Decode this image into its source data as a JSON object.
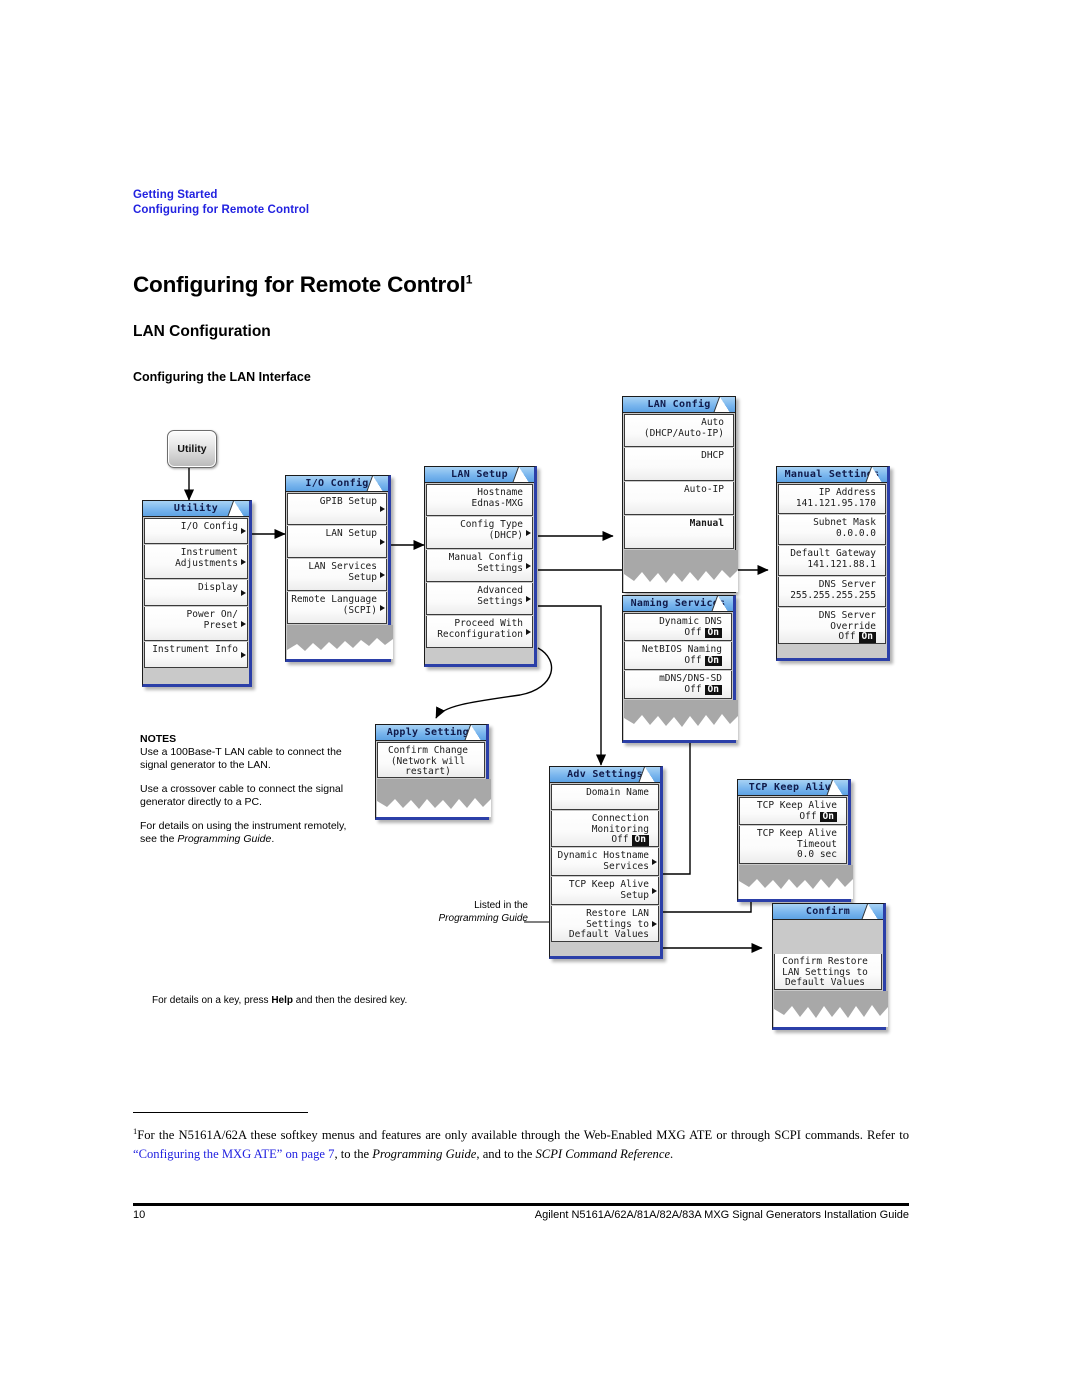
{
  "header": {
    "line1": "Getting Started",
    "line2": "Configuring for Remote Control",
    "color": "#2222e0"
  },
  "headings": {
    "title": "Configuring for Remote Control",
    "title_footnote_marker": "1",
    "h2": "LAN Configuration",
    "h3": "Configuring the LAN Interface"
  },
  "hardkey": {
    "label": "Utility"
  },
  "menus": {
    "utility": {
      "title": "Utility",
      "keys": [
        {
          "label": "I/O Config",
          "arrow": true
        },
        {
          "label": "Instrument\nAdjustments",
          "arrow": true
        },
        {
          "label": "Display",
          "arrow": true
        },
        {
          "label": "Power On/\nPreset",
          "arrow": true
        },
        {
          "label": "Instrument Info",
          "arrow": true
        }
      ]
    },
    "io_config": {
      "title": "I/O Config",
      "keys": [
        {
          "label": "GPIB Setup",
          "arrow": true
        },
        {
          "label": "LAN Setup",
          "arrow": true
        },
        {
          "label": "LAN Services\nSetup",
          "arrow": true
        },
        {
          "label": "Remote Language\n(SCPI)",
          "arrow": true
        }
      ]
    },
    "lan_setup": {
      "title": "LAN Setup",
      "keys": [
        {
          "label": "Hostname\nEdnas-MXG",
          "arrow": false
        },
        {
          "label": "Config Type\n(DHCP)",
          "arrow": true
        },
        {
          "label": "Manual Config\nSettings",
          "arrow": true
        },
        {
          "label": "Advanced\nSettings",
          "arrow": true
        },
        {
          "label": "Proceed With\nReconfiguration",
          "arrow": true
        }
      ]
    },
    "lan_config": {
      "title": "LAN Config",
      "keys": [
        {
          "label": "Auto\n(DHCP/Auto-IP)",
          "arrow": false
        },
        {
          "label": "DHCP",
          "arrow": false
        },
        {
          "label": "Auto-IP",
          "arrow": false
        },
        {
          "label": "Manual",
          "arrow": false,
          "selected": true
        }
      ]
    },
    "manual_settings": {
      "title": "Manual Settings",
      "keys": [
        {
          "label": "IP Address\n141.121.95.170",
          "arrow": false
        },
        {
          "label": "Subnet Mask\n0.0.0.0",
          "arrow": false
        },
        {
          "label": "Default Gateway\n141.121.88.1",
          "arrow": false
        },
        {
          "label": "DNS Server\n255.255.255.255",
          "arrow": false
        },
        {
          "label": "DNS Server\nOverride",
          "toggle_off": "Off",
          "toggle_on": "On",
          "arrow": false
        }
      ]
    },
    "naming_services": {
      "title": "Naming Services",
      "keys": [
        {
          "label": "Dynamic DNS",
          "toggle_off": "Off",
          "toggle_on": "On"
        },
        {
          "label": "NetBIOS Naming",
          "toggle_off": "Off",
          "toggle_on": "On"
        },
        {
          "label": "mDNS/DNS-SD",
          "toggle_off": "Off",
          "toggle_on": "On"
        }
      ]
    },
    "apply_settings": {
      "title": "Apply Settings",
      "keys": [
        {
          "label": "Confirm Change\n(Network will\nrestart)",
          "arrow": false
        }
      ]
    },
    "adv_settings": {
      "title": "Adv Settings",
      "keys": [
        {
          "label": "Domain Name",
          "arrow": false
        },
        {
          "label": "Connection\nMonitoring",
          "toggle_off": "Off",
          "toggle_on": "On"
        },
        {
          "label": "Dynamic Hostname\nServices",
          "arrow": true
        },
        {
          "label": "TCP Keep Alive\nSetup",
          "arrow": true
        },
        {
          "label": "Restore LAN\nSettings to\nDefault Values",
          "arrow": true
        }
      ]
    },
    "tcp_keep_alive": {
      "title": "TCP Keep Alive",
      "keys": [
        {
          "label": "TCP Keep Alive",
          "toggle_off": "Off",
          "toggle_on": "On"
        },
        {
          "label": "TCP Keep Alive\nTimeout\n0.0 sec",
          "arrow": false
        }
      ]
    },
    "confirm": {
      "title": "Confirm",
      "keys": [
        {
          "label": "Confirm Restore\nLAN Settings to\nDefault Values",
          "arrow": false
        }
      ]
    }
  },
  "notes": {
    "heading": "NOTES",
    "p1": "Use a 100Base-T LAN cable to connect the signal generator to the LAN.",
    "p2": "Use a crossover cable to connect the signal generator directly to a PC.",
    "p3_a": "For details on using the instrument remotely, see the ",
    "p3_em": "Programming Guide",
    "p3_b": "."
  },
  "callouts": {
    "listed_line1": "Listed in the",
    "listed_line2": "Programming Guide"
  },
  "help_line": {
    "a": "For details on a key, press ",
    "b": "Help",
    "c": " and then the desired key."
  },
  "footnote": {
    "marker": "1",
    "t1": "For the N5161A/62A these softkey menus and features are only available through the Web-Enabled MXG ATE or through SCPI commands. Refer to ",
    "link": "“Configuring the MXG ATE” on page 7",
    "t2": ", to the ",
    "em1": "Programming Guide",
    "t3": ", and to the ",
    "em2": "SCPI Command Reference",
    "t4": "."
  },
  "footer": {
    "page_number": "10",
    "title": "Agilent N5161A/62A/81A/82A/83A MXG Signal Generators Installation Guide"
  },
  "colors": {
    "header_blue": "#2222e0",
    "menu_title_blue": "#7ab6ee",
    "menu_border_blue": "#2b3fa8",
    "menu_body_gray": "#c9c9c9"
  }
}
